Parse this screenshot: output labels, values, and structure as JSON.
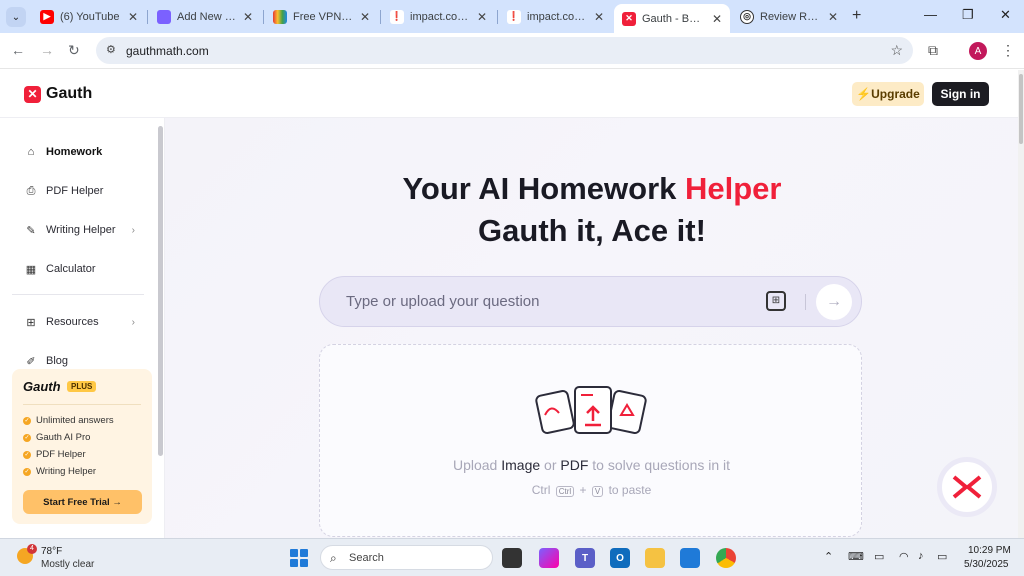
{
  "browser": {
    "tabs": [
      {
        "title": "(6) YouTube",
        "favicon_color": "#ff0000"
      },
      {
        "title": "Add New Post",
        "favicon_color": "#7b61ff"
      },
      {
        "title": "Free VPN for C",
        "favicon_color": "#f5a623"
      },
      {
        "title": "impact.com -",
        "favicon_color": "#e0245e"
      },
      {
        "title": "impact.com -",
        "favicon_color": "#e0245e"
      },
      {
        "title": "Gauth - Best A",
        "favicon_color": "#f0203a"
      },
      {
        "title": "Review Reque",
        "favicon_color": "#333333"
      }
    ],
    "url": "gauthmath.com",
    "profile_initial": "A"
  },
  "header": {
    "logo_text": "Gauth",
    "upgrade_label": "Upgrade",
    "signin_label": "Sign in"
  },
  "sidebar": {
    "items": [
      {
        "label": "Homework"
      },
      {
        "label": "PDF Helper"
      },
      {
        "label": "Writing Helper"
      },
      {
        "label": "Calculator"
      },
      {
        "label": "Resources"
      },
      {
        "label": "Blog"
      }
    ],
    "plus_card": {
      "title": "Gauth",
      "badge": "PLUS",
      "features": [
        "Unlimited answers",
        "Gauth AI Pro",
        "PDF Helper",
        "Writing Helper"
      ],
      "cta": "Start Free Trial"
    }
  },
  "main": {
    "hero_line1_prefix": "Your AI Homework ",
    "hero_line1_accent": "Helper",
    "hero_line2": "Gauth it, Ace it!",
    "question_placeholder": "Type or upload your question",
    "upload_prefix": "Upload ",
    "upload_image": "Image",
    "upload_or": " or ",
    "upload_pdf": "PDF",
    "upload_suffix": " to solve questions in it",
    "paste_ctrl": "Ctrl",
    "paste_key_ctrl": "Ctrl",
    "paste_plus": "+",
    "paste_key_v": "V",
    "paste_suffix": "to paste"
  },
  "taskbar": {
    "weather_temp": "78°F",
    "weather_cond": "Mostly clear",
    "weather_badge": "4",
    "search_label": "Search",
    "time": "10:29 PM",
    "date": "5/30/2025"
  },
  "colors": {
    "brand": "#f0203a",
    "upgrade_bg": "#fdebc6",
    "signin_bg": "#1c1c22",
    "plus_card_bg": "#fff4e3"
  }
}
